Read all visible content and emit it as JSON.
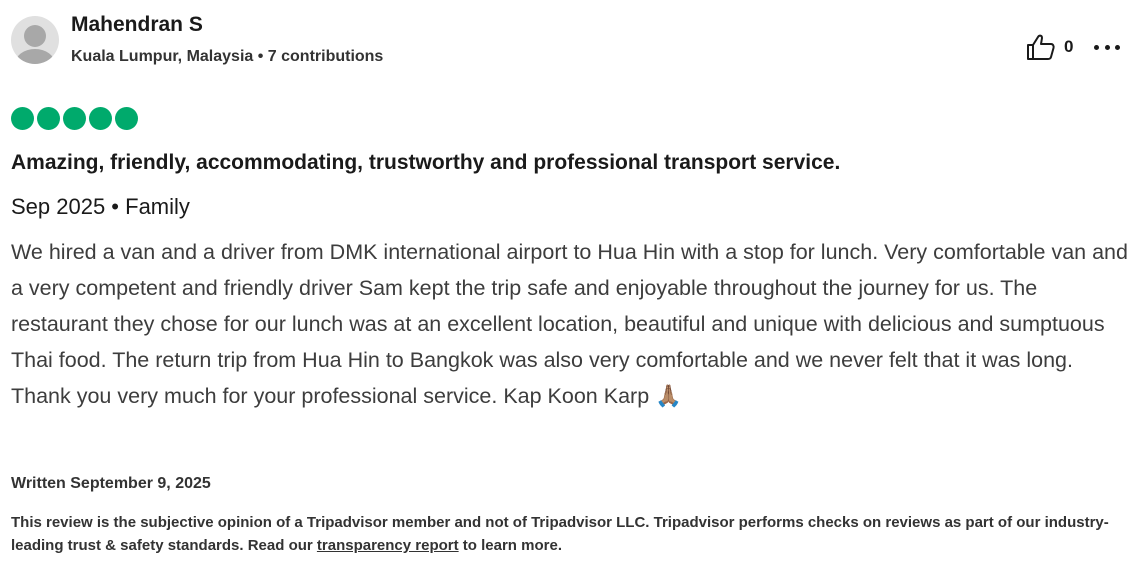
{
  "review": {
    "author": {
      "name": "Mahendran S",
      "meta": "Kuala Lumpur, Malaysia • 7 contributions"
    },
    "helpful_count": "0",
    "rating": {
      "value": 5,
      "max": 5,
      "color": "#00aa6c"
    },
    "title": "Amazing, friendly, accommodating, trustworthy and professional transport service.",
    "trip_info": "Sep 2025 • Family",
    "body": "We hired a van and a driver from DMK international airport to Hua Hin with a stop for lunch. Very comfortable van and a very competent and friendly driver Sam kept the trip safe and enjoyable throughout the journey for us. The restaurant they chose for our lunch was at an excellent location, beautiful and unique with delicious and sumptuous Thai food. The return trip from Hua Hin to Bangkok was also very comfortable and we never felt that it was long. Thank you very much for your professional service. Kap Koon Karp 🙏🏽",
    "written_date": "Written September 9, 2025"
  },
  "disclaimer": {
    "text_before": "This review is the subjective opinion of a Tripadvisor member and not of Tripadvisor LLC. Tripadvisor performs checks on reviews as part of our industry-leading trust & safety standards. Read our ",
    "link_text": "transparency report",
    "text_after": " to learn more."
  },
  "icons": {
    "avatar": "default-user-avatar",
    "helpful": "thumbs-up-outline-icon",
    "more": "more-horizontal-icon"
  }
}
